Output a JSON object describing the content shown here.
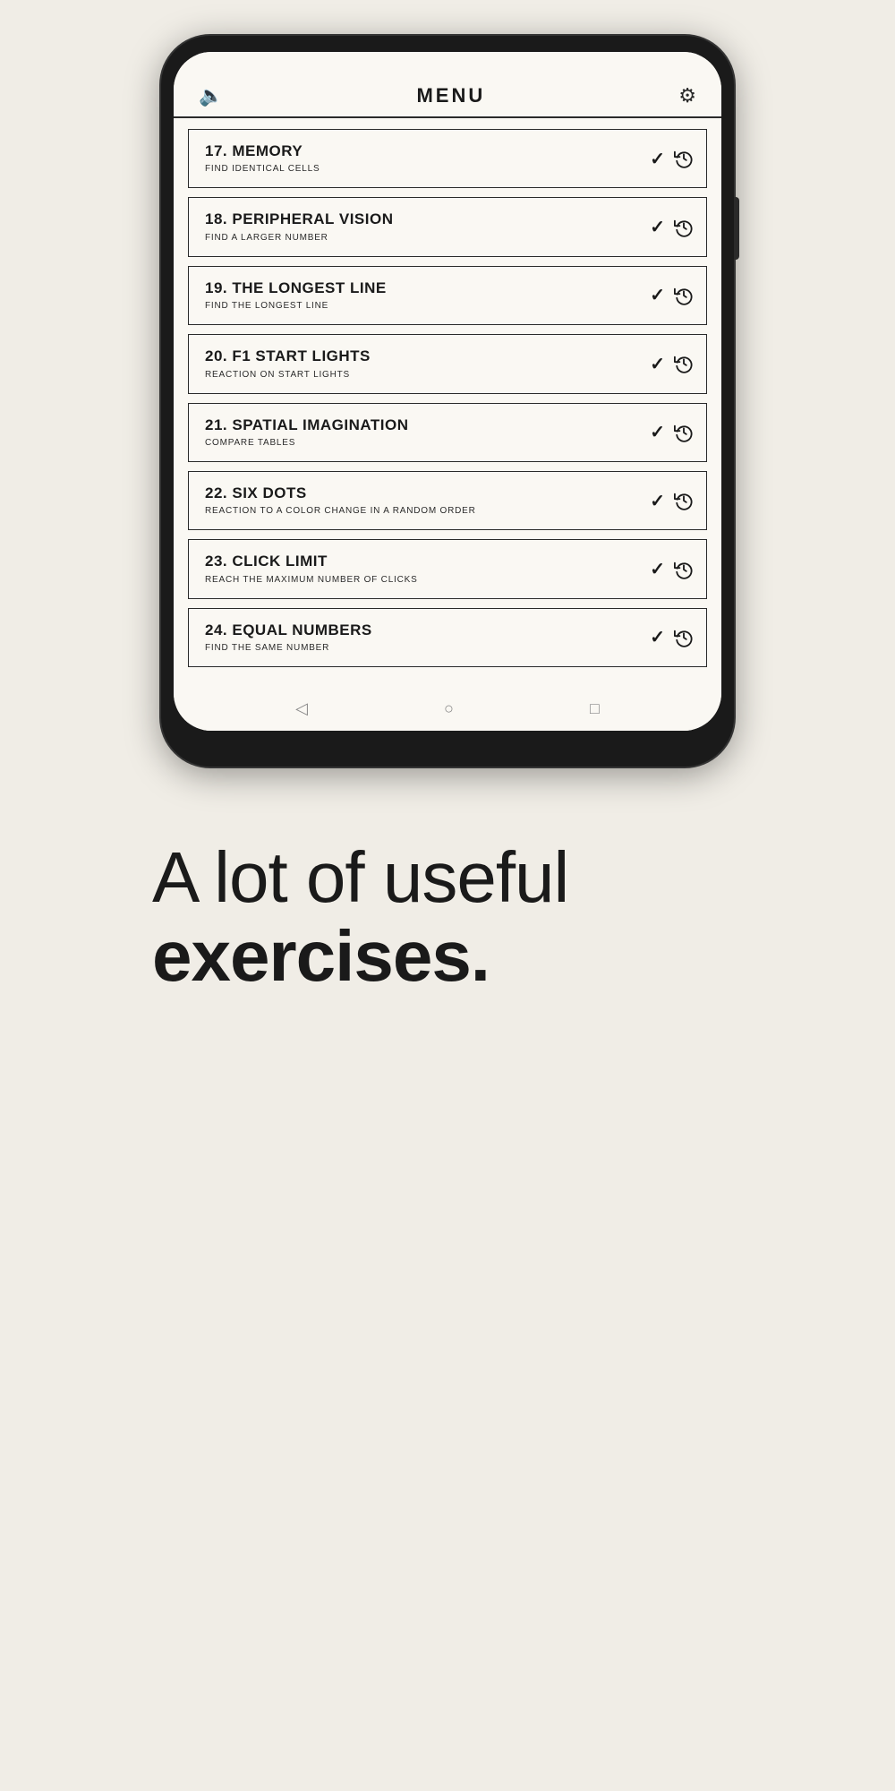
{
  "header": {
    "title": "MENU",
    "sound_icon": "🔈",
    "settings_icon": "⚙"
  },
  "menu_items": [
    {
      "number": "17.",
      "title": "MEMORY",
      "subtitle": "FIND IDENTICAL CELLS",
      "has_check": true,
      "has_history": true
    },
    {
      "number": "18.",
      "title": "PERIPHERAL VISION",
      "subtitle": "FIND A LARGER NUMBER",
      "has_check": true,
      "has_history": true
    },
    {
      "number": "19.",
      "title": "THE LONGEST LINE",
      "subtitle": "FIND THE LONGEST LINE",
      "has_check": true,
      "has_history": true
    },
    {
      "number": "20.",
      "title": "F1 START LIGHTS",
      "subtitle": "REACTION ON START LIGHTS",
      "has_check": true,
      "has_history": true
    },
    {
      "number": "21.",
      "title": "SPATIAL IMAGINATION",
      "subtitle": "COMPARE TABLES",
      "has_check": true,
      "has_history": true
    },
    {
      "number": "22.",
      "title": "SIX DOTS",
      "subtitle": "REACTION TO A COLOR CHANGE IN A RANDOM ORDER",
      "has_check": true,
      "has_history": true
    },
    {
      "number": "23.",
      "title": "CLICK LIMIT",
      "subtitle": "REACH THE MAXIMUM NUMBER OF CLICKS",
      "has_check": true,
      "has_history": true
    },
    {
      "number": "24.",
      "title": "EQUAL NUMBERS",
      "subtitle": "FIND THE SAME NUMBER",
      "has_check": true,
      "has_history": true
    }
  ],
  "bottom_text": {
    "line1": "A lot of useful",
    "line2": "exercises."
  }
}
